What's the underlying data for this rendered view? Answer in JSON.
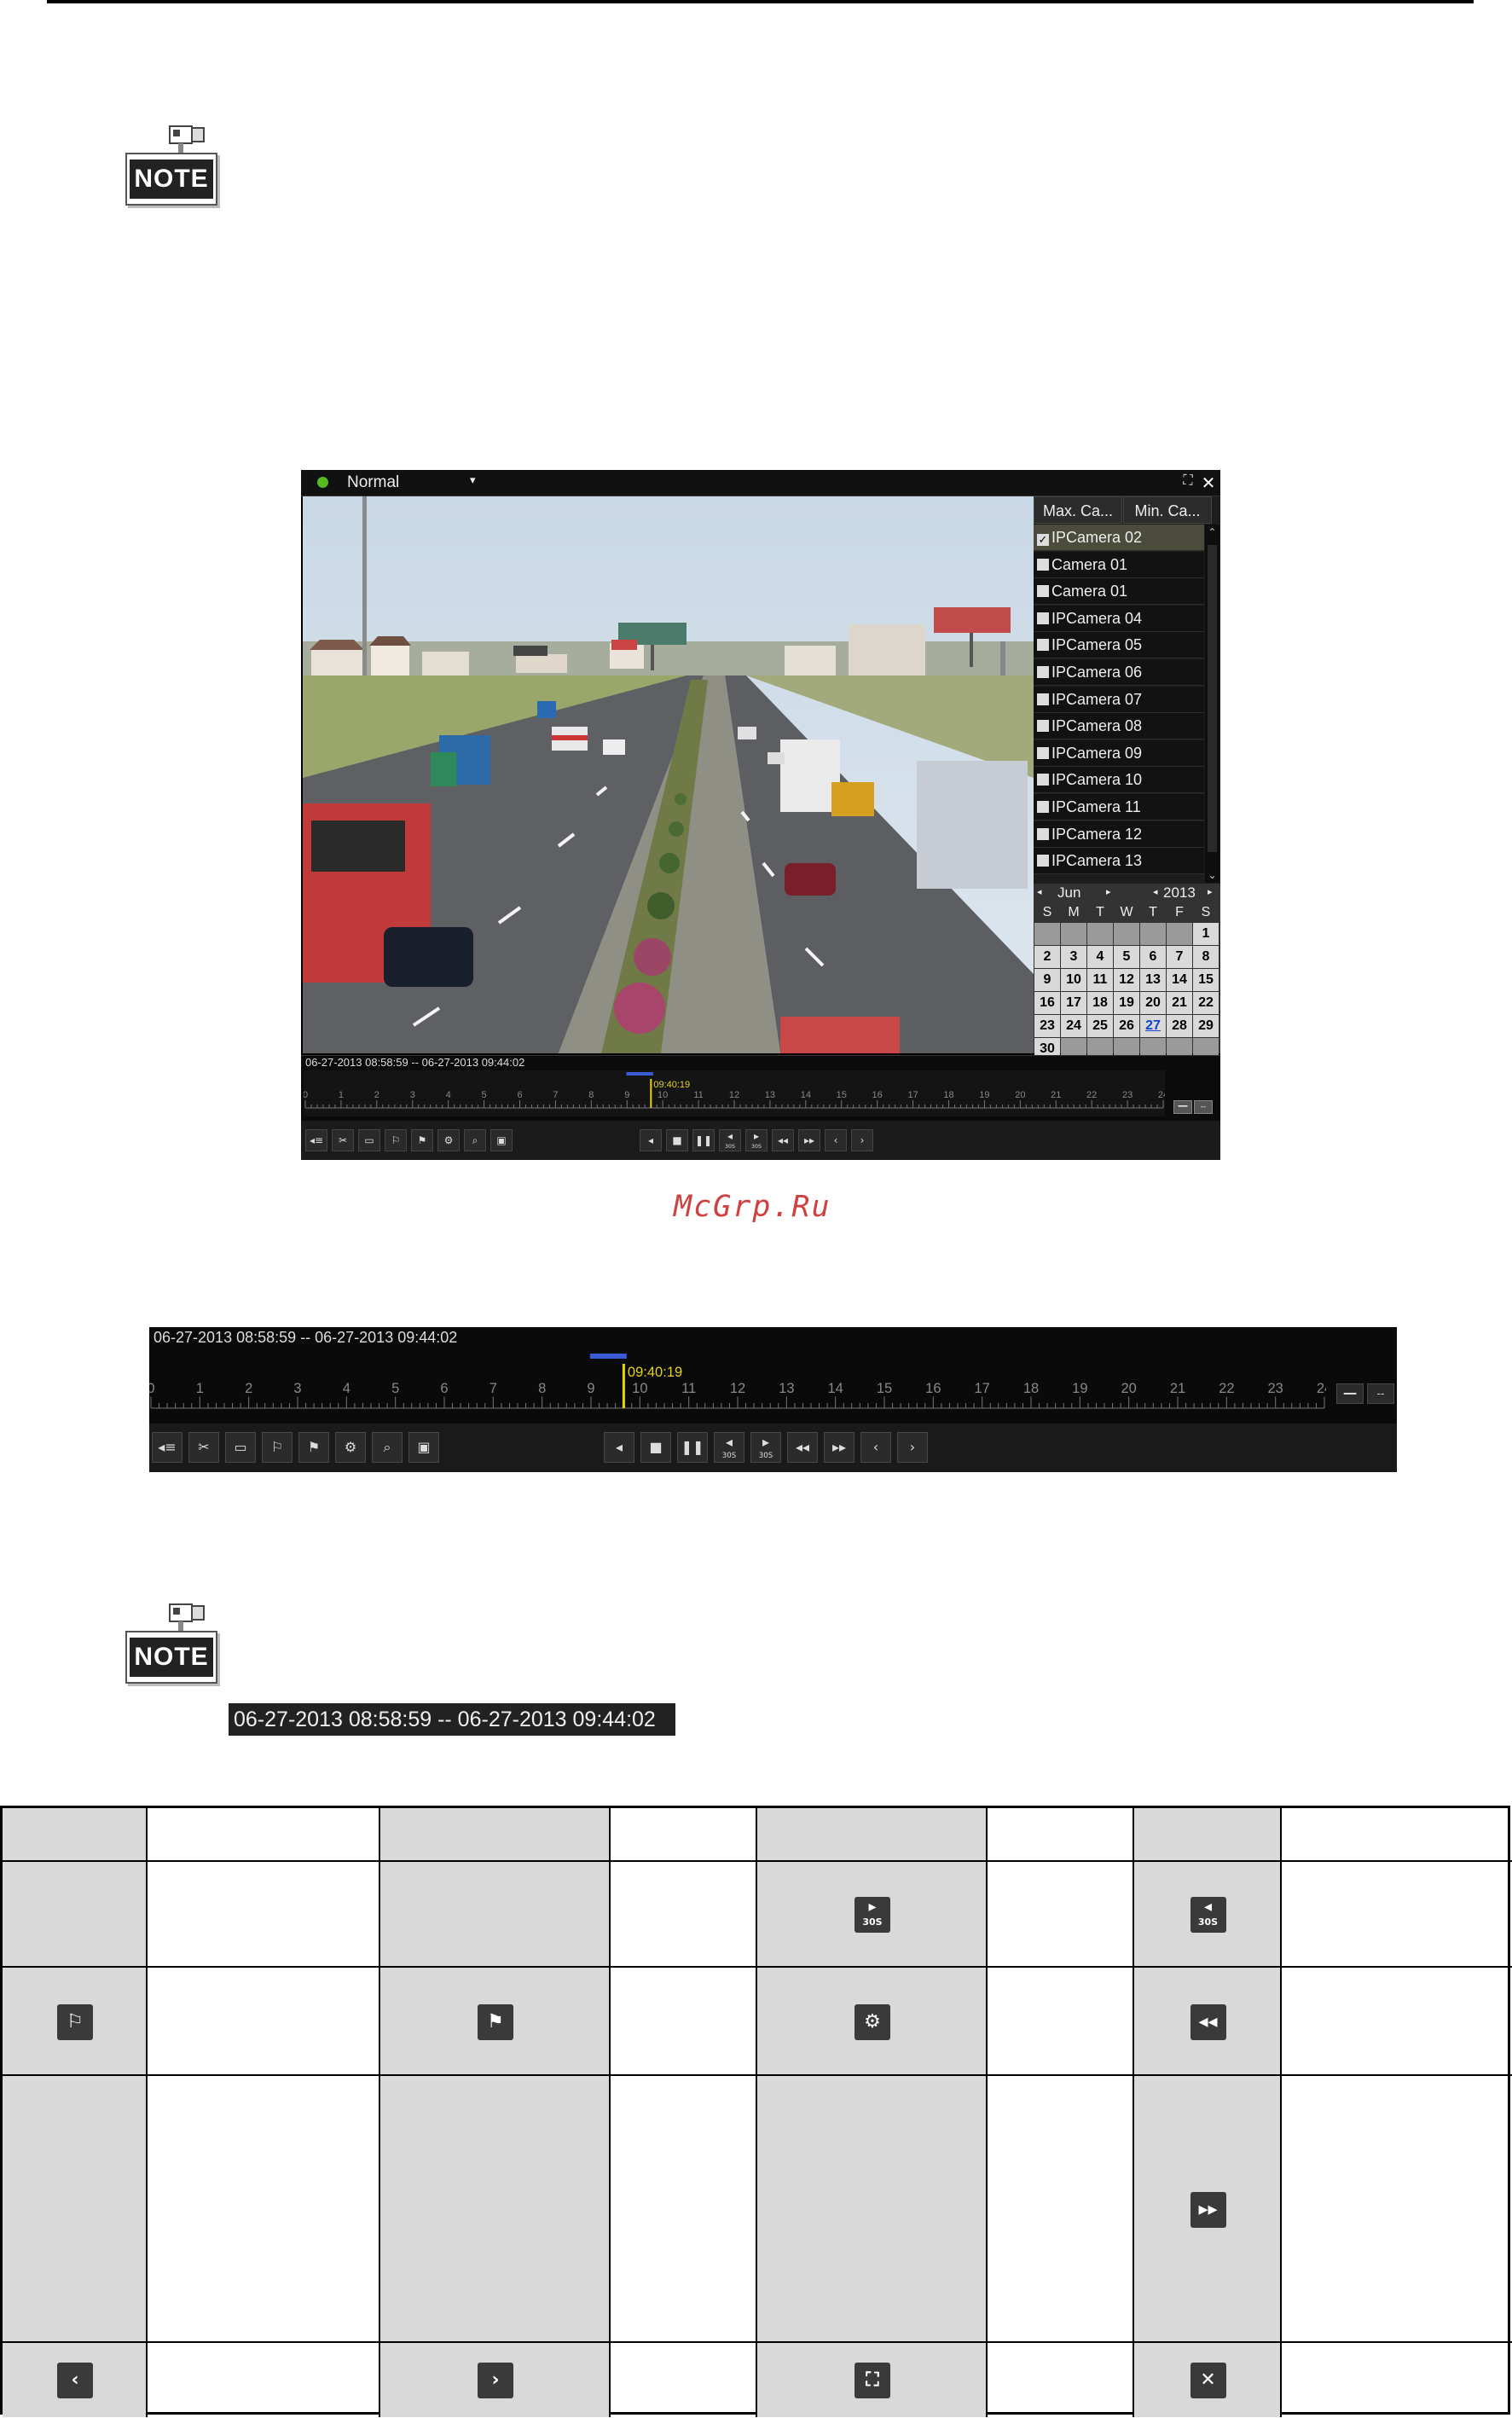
{
  "note_icon": {
    "label": "NOTE"
  },
  "watermark": "McGrp.Ru",
  "player": {
    "mode": "Normal",
    "tabs": [
      "Max. Ca...",
      "Min. Ca..."
    ],
    "cameras": [
      {
        "label": "IPCamera 02",
        "checked": true,
        "selected": true
      },
      {
        "label": "Camera 01",
        "checked": false
      },
      {
        "label": "Camera 01",
        "checked": false
      },
      {
        "label": "IPCamera 04",
        "checked": false
      },
      {
        "label": "IPCamera 05",
        "checked": false
      },
      {
        "label": "IPCamera 06",
        "checked": false
      },
      {
        "label": "IPCamera 07",
        "checked": false
      },
      {
        "label": "IPCamera 08",
        "checked": false
      },
      {
        "label": "IPCamera 09",
        "checked": false
      },
      {
        "label": "IPCamera 10",
        "checked": false
      },
      {
        "label": "IPCamera 11",
        "checked": false
      },
      {
        "label": "IPCamera 12",
        "checked": false
      },
      {
        "label": "IPCamera 13",
        "checked": false
      }
    ],
    "calendar": {
      "month": "Jun",
      "year": "2013",
      "weekdays": [
        "S",
        "M",
        "T",
        "W",
        "T",
        "F",
        "S"
      ],
      "leading_blanks": 6,
      "days_in_month": 30,
      "today": 27
    },
    "timeline": {
      "range": "06-27-2013 08:58:59 -- 06-27-2013 09:44:02",
      "cursor_time": "09:40:19",
      "cursor_hour": 9.67,
      "recorded_from_hour": 8.98,
      "recorded_to_hour": 9.73,
      "hour_labels": [
        "0",
        "1",
        "2",
        "3",
        "4",
        "5",
        "6",
        "7",
        "8",
        "9",
        "10",
        "11",
        "12",
        "13",
        "14",
        "15",
        "16",
        "17",
        "18",
        "19",
        "20",
        "21",
        "22",
        "23",
        "24"
      ]
    },
    "left_buttons": [
      {
        "name": "audio-icon",
        "glyph": "◂≡"
      },
      {
        "name": "clip-icon",
        "glyph": "✂"
      },
      {
        "name": "save-clip-icon",
        "glyph": "▭"
      },
      {
        "name": "add-tag-icon",
        "glyph": "⚐"
      },
      {
        "name": "custom-tag-icon",
        "glyph": "⚑"
      },
      {
        "name": "settings-icon",
        "glyph": "⚙"
      },
      {
        "name": "zoom-icon",
        "glyph": "⌕"
      },
      {
        "name": "snapshot-icon",
        "glyph": "▣"
      }
    ],
    "center_buttons": [
      {
        "name": "reverse-play-icon",
        "glyph": "◂"
      },
      {
        "name": "stop-icon",
        "glyph": "■"
      },
      {
        "name": "pause-icon",
        "glyph": "❚❚"
      },
      {
        "name": "back-30s-icon",
        "glyph": "◂"
      },
      {
        "name": "forward-30s-icon",
        "glyph": "▸"
      },
      {
        "name": "slow-icon",
        "glyph": "◂◂"
      },
      {
        "name": "fast-icon",
        "glyph": "▸▸"
      },
      {
        "name": "prev-day-icon",
        "glyph": "‹"
      },
      {
        "name": "next-day-icon",
        "glyph": "›"
      }
    ],
    "btn_30s_label": "30S"
  },
  "time_strip": "06-27-2013 08:58:59 -- 06-27-2013 09:44:02",
  "table": {
    "icons": [
      [
        "",
        "",
        "forward-30s-icon",
        "back-30s-icon"
      ],
      [
        "add-tag-icon",
        "custom-tag-icon",
        "settings-icon",
        "slow-forward-icon"
      ],
      [
        "",
        "",
        "",
        "fast-forward-icon"
      ],
      [
        "prev-day-icon",
        "next-day-icon",
        "fullscreen-icon",
        "close-icon"
      ]
    ]
  },
  "colors": {
    "timeline_cursor": "#e6d21a",
    "record_bar": "#3b5bd6",
    "watermark": "#d04040"
  }
}
